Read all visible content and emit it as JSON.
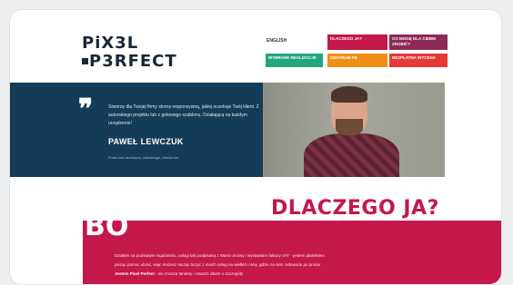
{
  "logo": {
    "line1": "PiX3L",
    "line2": "P3RFECT"
  },
  "nav": {
    "language": "ENGLISH",
    "buttons": [
      "DLACZEGO JA?",
      "CO MOGĘ DLA CIEBIE ZROBIĆ?",
      "WYBRANE REALIZACJE",
      "CENTRUM FB",
      "BEZPŁATNA WYCENA"
    ],
    "colors": {
      "red": "#c4184a",
      "plum": "#8d2a55",
      "green": "#23a67f",
      "orange": "#ef8f17",
      "brightred": "#e53935"
    }
  },
  "hero": {
    "quote": "Stworzę dla Twojej firmy stronę responsywną, jakiej oczekuje Twój klient. Z autorskiego projektu lub z gotowego szablonu. Działającą na każdym urządzeniu!",
    "author": "PAWEŁ LEWCZUK",
    "author_sub": "Front-end developer, webdesign, freelancer"
  },
  "section": {
    "title": "DLACZEGO JA?",
    "big_letters": "BO",
    "line1": "Działam na podstawie regulaminu, usługi tak podpisaną z Wami umowy i wystawiam faktury VAT - jestem płatnikiem",
    "line2": "pisząc pomoc ubrać, wiąc możesz racząc liczyć z moich usług na wielkim ceny, gdzie za nimi rodowodu po prostu",
    "line3_bold": "Jestem Pixel Perfect",
    "line3": " - nie znoszę tandety i zawsze dbam o szczegóły"
  }
}
